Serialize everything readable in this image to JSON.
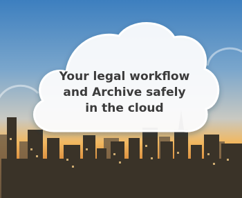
{
  "banner": {
    "headline_lines": [
      "Your legal workflow",
      "and Archive safely",
      "in the cloud"
    ]
  },
  "colors": {
    "sky_top": "#3d7fbf",
    "sky_mid": "#8fb2cf",
    "horizon_glow": "#f1b860",
    "city_dark": "#3a3328",
    "cloud_fill": "#ffffff",
    "headline_text": "#3b3b3b"
  }
}
